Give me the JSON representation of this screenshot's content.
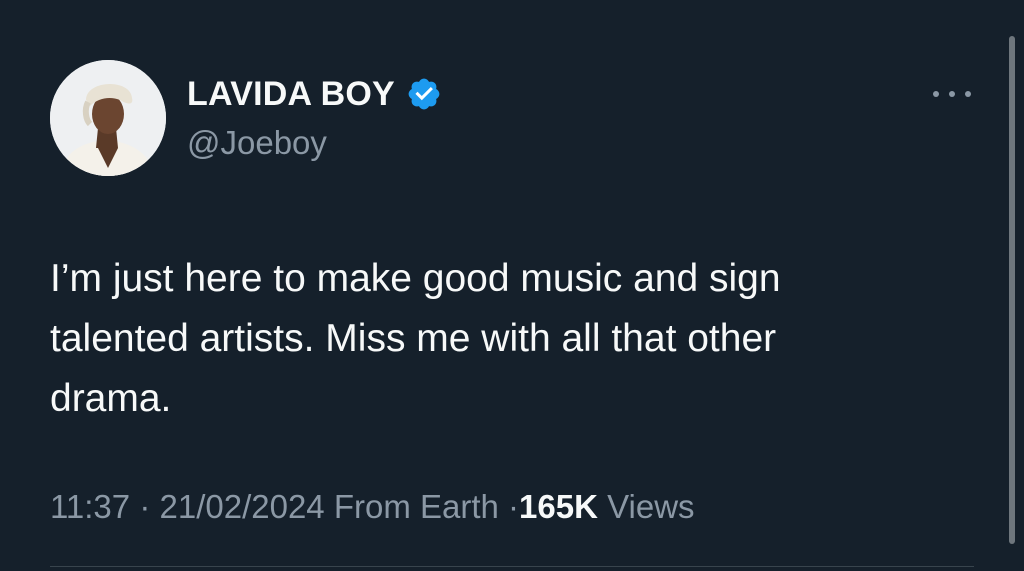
{
  "author": {
    "display_name": "LAVIDA BOY",
    "handle": "@Joeboy",
    "verified": true,
    "verified_color": "#1d9bf0"
  },
  "tweet": {
    "text": "I’m just here to make good music and sign\ntalented artists. Miss me with all that other\ndrama."
  },
  "meta": {
    "time": "11:37",
    "separator": "·",
    "date": "21/02/2024",
    "source": "From Earth",
    "views_count": "165K",
    "views_label": "Views"
  },
  "icons": {
    "more": "more-options-icon",
    "verified": "verified-badge-icon"
  },
  "colors": {
    "background": "#15202b",
    "primary_text": "#f7f9f9",
    "secondary_text": "#8b98a5"
  }
}
